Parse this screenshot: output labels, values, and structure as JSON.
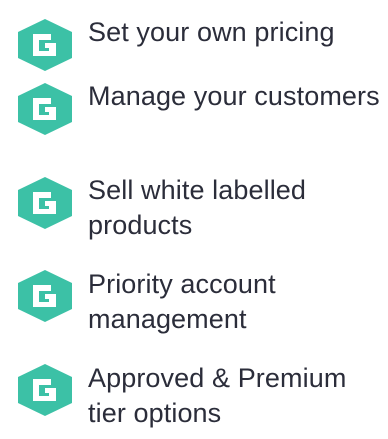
{
  "brand_color": "#3cc1a6",
  "text_color": "#2b2d3a",
  "features": [
    {
      "icon": "brand-logo-icon",
      "label": "Set your own pricing"
    },
    {
      "icon": "brand-logo-icon",
      "label": "Manage your customers"
    },
    {
      "icon": "brand-logo-icon",
      "label": "Sell white labelled products"
    },
    {
      "icon": "brand-logo-icon",
      "label": "Priority account management"
    },
    {
      "icon": "brand-logo-icon",
      "label": "Approved & Premium tier options"
    }
  ]
}
